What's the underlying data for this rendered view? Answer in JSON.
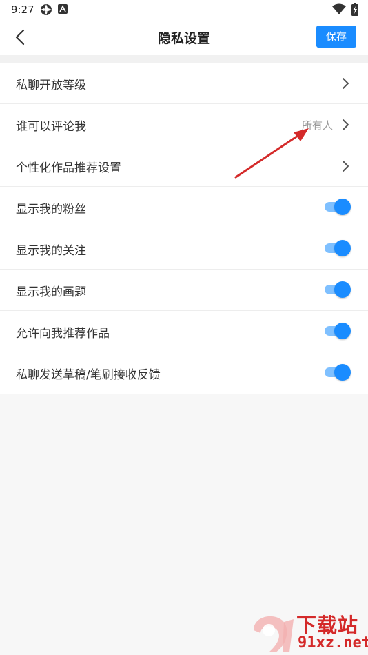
{
  "status_bar": {
    "time": "9:27",
    "icons": [
      "settings-gear-icon",
      "a-letter-icon",
      "wifi-icon",
      "battery-icon"
    ]
  },
  "app_bar": {
    "back_icon": "chevron-left-icon",
    "title": "隐私设置",
    "save_label": "保存"
  },
  "settings": {
    "items": [
      {
        "label": "私聊开放等级",
        "type": "link"
      },
      {
        "label": "谁可以评论我",
        "type": "link",
        "value": "所有人"
      },
      {
        "label": "个性化作品推荐设置",
        "type": "link"
      },
      {
        "label": "显示我的粉丝",
        "type": "toggle",
        "on": true
      },
      {
        "label": "显示我的关注",
        "type": "toggle",
        "on": true
      },
      {
        "label": "显示我的画题",
        "type": "toggle",
        "on": true
      },
      {
        "label": "允许向我推荐作品",
        "type": "toggle",
        "on": true
      },
      {
        "label": "私聊发送草稿/笔刷接收反馈",
        "type": "toggle",
        "on": true
      }
    ]
  },
  "watermark": {
    "top_text": "下载站",
    "bottom_text": "91xz.net"
  },
  "colors": {
    "accent": "#1a8cff",
    "toggle_track": "#7fc0ff",
    "annotation_arrow": "#d42a2a"
  }
}
